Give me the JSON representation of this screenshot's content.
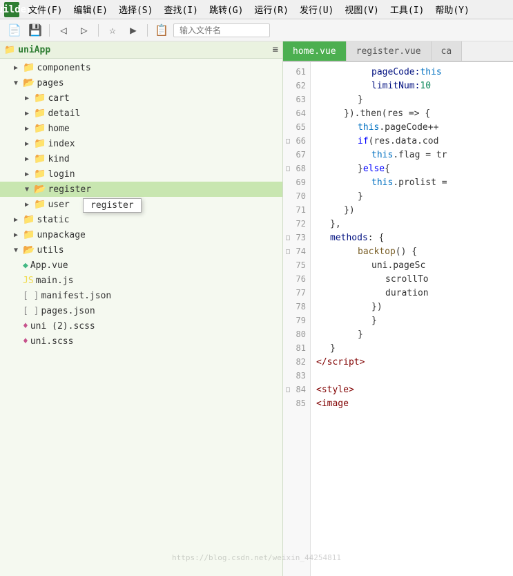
{
  "app": {
    "title": "HBuilderX"
  },
  "menubar": {
    "logo": "H",
    "items": [
      {
        "label": "文件(F)"
      },
      {
        "label": "编辑(E)"
      },
      {
        "label": "选择(S)"
      },
      {
        "label": "查找(I)"
      },
      {
        "label": "跳转(G)"
      },
      {
        "label": "运行(R)"
      },
      {
        "label": "发行(U)"
      },
      {
        "label": "视图(V)"
      },
      {
        "label": "工具(I)"
      },
      {
        "label": "帮助(Y)"
      }
    ]
  },
  "toolbar": {
    "file_placeholder": "输入文件名"
  },
  "sidebar": {
    "hamburger": "≡",
    "root": {
      "label": "uniApp",
      "icon": "folder"
    },
    "tree": [
      {
        "id": "components",
        "label": "components",
        "indent": 2,
        "type": "folder",
        "state": "closed"
      },
      {
        "id": "pages",
        "label": "pages",
        "indent": 2,
        "type": "folder",
        "state": "open"
      },
      {
        "id": "cart",
        "label": "cart",
        "indent": 3,
        "type": "folder",
        "state": "closed"
      },
      {
        "id": "detail",
        "label": "detail",
        "indent": 3,
        "type": "folder",
        "state": "closed"
      },
      {
        "id": "home",
        "label": "home",
        "indent": 3,
        "type": "folder",
        "state": "closed"
      },
      {
        "id": "index",
        "label": "index",
        "indent": 3,
        "type": "folder",
        "state": "closed"
      },
      {
        "id": "kind",
        "label": "kind",
        "indent": 3,
        "type": "folder",
        "state": "closed"
      },
      {
        "id": "login",
        "label": "login",
        "indent": 3,
        "type": "folder",
        "state": "closed"
      },
      {
        "id": "register",
        "label": "register",
        "indent": 3,
        "type": "folder",
        "state": "open",
        "selected": true
      },
      {
        "id": "user",
        "label": "user",
        "indent": 3,
        "type": "folder",
        "state": "closed",
        "tooltip": "register"
      },
      {
        "id": "static",
        "label": "static",
        "indent": 2,
        "type": "folder",
        "state": "closed"
      },
      {
        "id": "unpackage",
        "label": "unpackage",
        "indent": 2,
        "type": "folder",
        "state": "closed"
      },
      {
        "id": "utils",
        "label": "utils",
        "indent": 2,
        "type": "folder",
        "state": "open"
      },
      {
        "id": "App.vue",
        "label": "App.vue",
        "indent": 2,
        "type": "vue"
      },
      {
        "id": "main.js",
        "label": "main.js",
        "indent": 2,
        "type": "js"
      },
      {
        "id": "manifest.json",
        "label": "manifest.json",
        "indent": 2,
        "type": "json"
      },
      {
        "id": "pages.json",
        "label": "pages.json",
        "indent": 2,
        "type": "json"
      },
      {
        "id": "uni2.scss",
        "label": "uni (2).scss",
        "indent": 2,
        "type": "scss"
      },
      {
        "id": "uni.scss",
        "label": "uni.scss",
        "indent": 2,
        "type": "scss"
      }
    ]
  },
  "editor": {
    "tabs": [
      {
        "label": "home.vue",
        "active": true
      },
      {
        "label": "register.vue",
        "active": false
      },
      {
        "label": "ca",
        "active": false,
        "truncated": true
      }
    ],
    "lines": [
      {
        "num": 61,
        "fold": null,
        "content": [
          {
            "t": "prop",
            "v": "pageCode: "
          },
          {
            "t": "this-kw",
            "v": "this"
          }
        ]
      },
      {
        "num": 62,
        "fold": null,
        "content": [
          {
            "t": "prop",
            "v": "limitNum: "
          },
          {
            "t": "num",
            "v": "10"
          }
        ]
      },
      {
        "num": 63,
        "fold": null,
        "content": [
          {
            "t": "punct",
            "v": "        }"
          }
        ]
      },
      {
        "num": 64,
        "fold": null,
        "content": [
          {
            "t": "punct",
            "v": "    }).then(res => {"
          }
        ]
      },
      {
        "num": 65,
        "fold": null,
        "content": [
          {
            "t": "this-kw",
            "v": "this"
          },
          {
            "t": "punct",
            "v": ".pageCode++"
          }
        ]
      },
      {
        "num": 66,
        "fold": "open",
        "content": [
          {
            "t": "kw",
            "v": "if"
          },
          {
            "t": "punct",
            "v": " (res.data.cod"
          }
        ]
      },
      {
        "num": 67,
        "fold": null,
        "content": [
          {
            "t": "this-kw",
            "v": "this"
          },
          {
            "t": "punct",
            "v": ".flag = tr"
          }
        ]
      },
      {
        "num": 68,
        "fold": "open",
        "content": [
          {
            "t": "punct",
            "v": "} "
          },
          {
            "t": "kw",
            "v": "else"
          },
          {
            "t": "punct",
            "v": " {"
          }
        ]
      },
      {
        "num": 69,
        "fold": null,
        "content": [
          {
            "t": "this-kw",
            "v": "this"
          },
          {
            "t": "punct",
            "v": ".prolist ="
          }
        ]
      },
      {
        "num": 70,
        "fold": null,
        "content": [
          {
            "t": "punct",
            "v": "        }"
          }
        ]
      },
      {
        "num": 71,
        "fold": null,
        "content": [
          {
            "t": "punct",
            "v": "    })"
          }
        ]
      },
      {
        "num": 72,
        "fold": null,
        "content": [
          {
            "t": "punct",
            "v": "  },"
          }
        ]
      },
      {
        "num": 73,
        "fold": "open",
        "content": [
          {
            "t": "prop",
            "v": "methods"
          },
          {
            "t": "punct",
            "v": ": {"
          }
        ]
      },
      {
        "num": 74,
        "fold": "open",
        "content": [
          {
            "t": "fn",
            "v": "backtop"
          },
          {
            "t": "punct",
            "v": " () {"
          }
        ]
      },
      {
        "num": 75,
        "fold": null,
        "content": [
          {
            "t": "punct",
            "v": "        uni.pageSc"
          }
        ]
      },
      {
        "num": 76,
        "fold": null,
        "content": [
          {
            "t": "punct",
            "v": "            scrollTo"
          }
        ]
      },
      {
        "num": 77,
        "fold": null,
        "content": [
          {
            "t": "punct",
            "v": "            duration"
          }
        ]
      },
      {
        "num": 78,
        "fold": null,
        "content": [
          {
            "t": "punct",
            "v": "        })"
          }
        ]
      },
      {
        "num": 79,
        "fold": null,
        "content": [
          {
            "t": "punct",
            "v": "        }"
          }
        ]
      },
      {
        "num": 80,
        "fold": null,
        "content": [
          {
            "t": "punct",
            "v": "    }"
          }
        ]
      },
      {
        "num": 81,
        "fold": null,
        "content": [
          {
            "t": "punct",
            "v": "  }"
          }
        ]
      },
      {
        "num": 82,
        "fold": null,
        "content": [
          {
            "t": "tag",
            "v": "</script"
          },
          {
            "t": "tag",
            "v": ">"
          }
        ]
      },
      {
        "num": 83,
        "fold": null,
        "content": []
      },
      {
        "num": 84,
        "fold": "open",
        "content": [
          {
            "t": "tag",
            "v": "<style"
          },
          {
            "t": "tag",
            "v": ">"
          }
        ]
      },
      {
        "num": 85,
        "fold": null,
        "content": [
          {
            "t": "tag",
            "v": "<image"
          }
        ]
      }
    ]
  },
  "watermark": "https://blog.csdn.net/weixin_44254811"
}
